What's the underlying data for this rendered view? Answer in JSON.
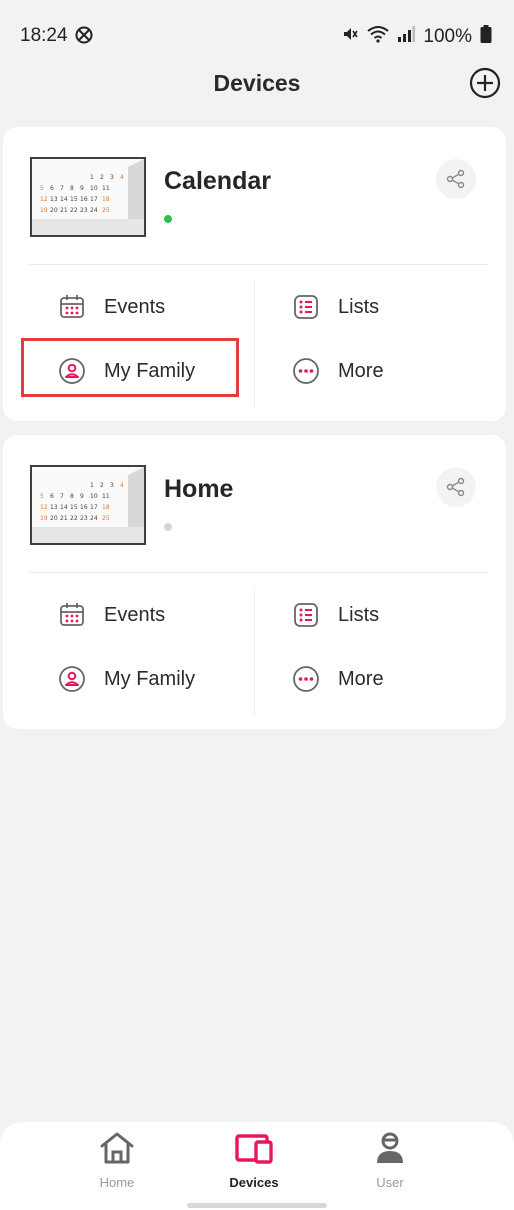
{
  "status_bar": {
    "time": "18:24",
    "battery": "100%"
  },
  "header": {
    "title": "Devices"
  },
  "devices": [
    {
      "name": "Calendar",
      "online": true,
      "actions": {
        "events": "Events",
        "lists": "Lists",
        "family": "My Family",
        "more": "More"
      }
    },
    {
      "name": "Home",
      "online": false,
      "actions": {
        "events": "Events",
        "lists": "Lists",
        "family": "My Family",
        "more": "More"
      }
    }
  ],
  "bottom_nav": [
    {
      "label": "Home",
      "icon": "home-icon",
      "active": false
    },
    {
      "label": "Devices",
      "icon": "devices-icon",
      "active": true
    },
    {
      "label": "User",
      "icon": "user-icon",
      "active": false
    }
  ],
  "colors": {
    "accent": "#e8175d",
    "online": "#2fbf4f",
    "offline": "#d6d6d6",
    "highlight": "#e03d3d"
  }
}
